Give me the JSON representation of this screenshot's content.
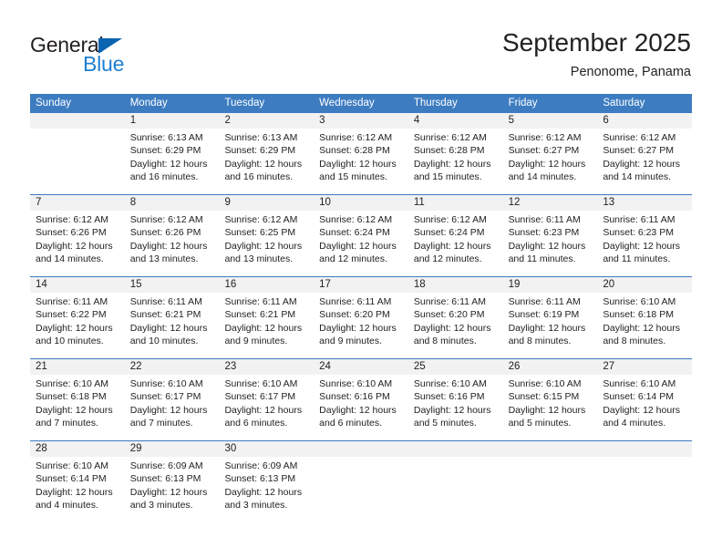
{
  "brand": {
    "name_top": "General",
    "name_bottom": "Blue",
    "triangle_color": "#0b64b0",
    "blue_color": "#1f7fd0",
    "dark_color": "#231f20"
  },
  "header": {
    "title": "September 2025",
    "subtitle": "Penonome, Panama",
    "accent_color": "#3d7cc0"
  },
  "calendar": {
    "weekdays": [
      "Sunday",
      "Monday",
      "Tuesday",
      "Wednesday",
      "Thursday",
      "Friday",
      "Saturday"
    ],
    "weeks": [
      [
        {
          "day": "",
          "lines": []
        },
        {
          "day": "1",
          "lines": [
            "Sunrise: 6:13 AM",
            "Sunset: 6:29 PM",
            "Daylight: 12 hours",
            "and 16 minutes."
          ]
        },
        {
          "day": "2",
          "lines": [
            "Sunrise: 6:13 AM",
            "Sunset: 6:29 PM",
            "Daylight: 12 hours",
            "and 16 minutes."
          ]
        },
        {
          "day": "3",
          "lines": [
            "Sunrise: 6:12 AM",
            "Sunset: 6:28 PM",
            "Daylight: 12 hours",
            "and 15 minutes."
          ]
        },
        {
          "day": "4",
          "lines": [
            "Sunrise: 6:12 AM",
            "Sunset: 6:28 PM",
            "Daylight: 12 hours",
            "and 15 minutes."
          ]
        },
        {
          "day": "5",
          "lines": [
            "Sunrise: 6:12 AM",
            "Sunset: 6:27 PM",
            "Daylight: 12 hours",
            "and 14 minutes."
          ]
        },
        {
          "day": "6",
          "lines": [
            "Sunrise: 6:12 AM",
            "Sunset: 6:27 PM",
            "Daylight: 12 hours",
            "and 14 minutes."
          ]
        }
      ],
      [
        {
          "day": "7",
          "lines": [
            "Sunrise: 6:12 AM",
            "Sunset: 6:26 PM",
            "Daylight: 12 hours",
            "and 14 minutes."
          ]
        },
        {
          "day": "8",
          "lines": [
            "Sunrise: 6:12 AM",
            "Sunset: 6:26 PM",
            "Daylight: 12 hours",
            "and 13 minutes."
          ]
        },
        {
          "day": "9",
          "lines": [
            "Sunrise: 6:12 AM",
            "Sunset: 6:25 PM",
            "Daylight: 12 hours",
            "and 13 minutes."
          ]
        },
        {
          "day": "10",
          "lines": [
            "Sunrise: 6:12 AM",
            "Sunset: 6:24 PM",
            "Daylight: 12 hours",
            "and 12 minutes."
          ]
        },
        {
          "day": "11",
          "lines": [
            "Sunrise: 6:12 AM",
            "Sunset: 6:24 PM",
            "Daylight: 12 hours",
            "and 12 minutes."
          ]
        },
        {
          "day": "12",
          "lines": [
            "Sunrise: 6:11 AM",
            "Sunset: 6:23 PM",
            "Daylight: 12 hours",
            "and 11 minutes."
          ]
        },
        {
          "day": "13",
          "lines": [
            "Sunrise: 6:11 AM",
            "Sunset: 6:23 PM",
            "Daylight: 12 hours",
            "and 11 minutes."
          ]
        }
      ],
      [
        {
          "day": "14",
          "lines": [
            "Sunrise: 6:11 AM",
            "Sunset: 6:22 PM",
            "Daylight: 12 hours",
            "and 10 minutes."
          ]
        },
        {
          "day": "15",
          "lines": [
            "Sunrise: 6:11 AM",
            "Sunset: 6:21 PM",
            "Daylight: 12 hours",
            "and 10 minutes."
          ]
        },
        {
          "day": "16",
          "lines": [
            "Sunrise: 6:11 AM",
            "Sunset: 6:21 PM",
            "Daylight: 12 hours",
            "and 9 minutes."
          ]
        },
        {
          "day": "17",
          "lines": [
            "Sunrise: 6:11 AM",
            "Sunset: 6:20 PM",
            "Daylight: 12 hours",
            "and 9 minutes."
          ]
        },
        {
          "day": "18",
          "lines": [
            "Sunrise: 6:11 AM",
            "Sunset: 6:20 PM",
            "Daylight: 12 hours",
            "and 8 minutes."
          ]
        },
        {
          "day": "19",
          "lines": [
            "Sunrise: 6:11 AM",
            "Sunset: 6:19 PM",
            "Daylight: 12 hours",
            "and 8 minutes."
          ]
        },
        {
          "day": "20",
          "lines": [
            "Sunrise: 6:10 AM",
            "Sunset: 6:18 PM",
            "Daylight: 12 hours",
            "and 8 minutes."
          ]
        }
      ],
      [
        {
          "day": "21",
          "lines": [
            "Sunrise: 6:10 AM",
            "Sunset: 6:18 PM",
            "Daylight: 12 hours",
            "and 7 minutes."
          ]
        },
        {
          "day": "22",
          "lines": [
            "Sunrise: 6:10 AM",
            "Sunset: 6:17 PM",
            "Daylight: 12 hours",
            "and 7 minutes."
          ]
        },
        {
          "day": "23",
          "lines": [
            "Sunrise: 6:10 AM",
            "Sunset: 6:17 PM",
            "Daylight: 12 hours",
            "and 6 minutes."
          ]
        },
        {
          "day": "24",
          "lines": [
            "Sunrise: 6:10 AM",
            "Sunset: 6:16 PM",
            "Daylight: 12 hours",
            "and 6 minutes."
          ]
        },
        {
          "day": "25",
          "lines": [
            "Sunrise: 6:10 AM",
            "Sunset: 6:16 PM",
            "Daylight: 12 hours",
            "and 5 minutes."
          ]
        },
        {
          "day": "26",
          "lines": [
            "Sunrise: 6:10 AM",
            "Sunset: 6:15 PM",
            "Daylight: 12 hours",
            "and 5 minutes."
          ]
        },
        {
          "day": "27",
          "lines": [
            "Sunrise: 6:10 AM",
            "Sunset: 6:14 PM",
            "Daylight: 12 hours",
            "and 4 minutes."
          ]
        }
      ],
      [
        {
          "day": "28",
          "lines": [
            "Sunrise: 6:10 AM",
            "Sunset: 6:14 PM",
            "Daylight: 12 hours",
            "and 4 minutes."
          ]
        },
        {
          "day": "29",
          "lines": [
            "Sunrise: 6:09 AM",
            "Sunset: 6:13 PM",
            "Daylight: 12 hours",
            "and 3 minutes."
          ]
        },
        {
          "day": "30",
          "lines": [
            "Sunrise: 6:09 AM",
            "Sunset: 6:13 PM",
            "Daylight: 12 hours",
            "and 3 minutes."
          ]
        },
        {
          "day": "",
          "lines": []
        },
        {
          "day": "",
          "lines": []
        },
        {
          "day": "",
          "lines": []
        },
        {
          "day": "",
          "lines": []
        }
      ]
    ]
  }
}
